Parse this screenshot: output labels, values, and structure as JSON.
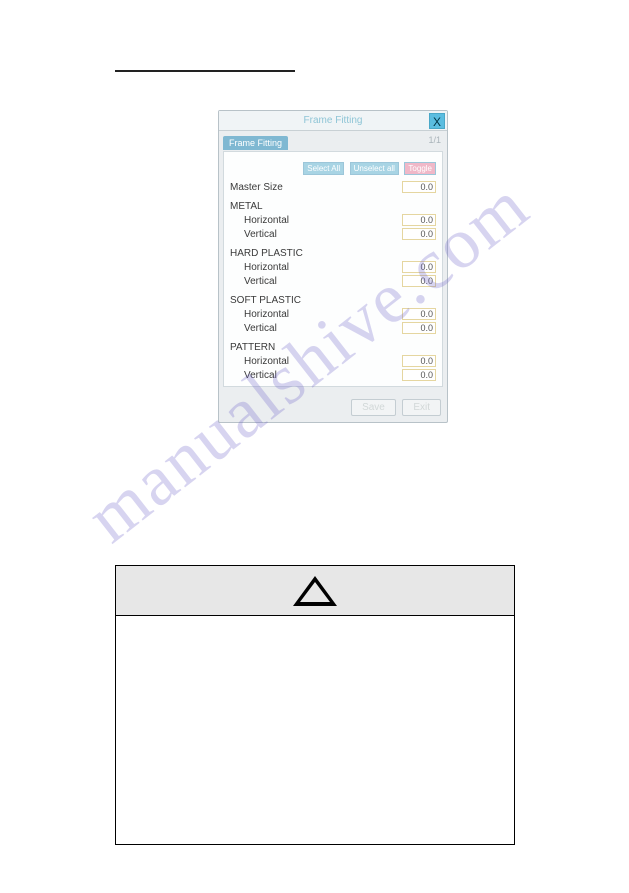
{
  "dialog": {
    "title": "Frame Fitting",
    "close": "X",
    "tab": "Frame Fitting",
    "pager": "1/1",
    "buttons": {
      "selectAll": "Select All",
      "unselectAll": "Unselect all",
      "toggle": "Toggle"
    },
    "master": {
      "label": "Master Size",
      "value": "0.0"
    },
    "groups": [
      {
        "name": "METAL",
        "rows": [
          {
            "label": "Horizontal",
            "value": "0.0"
          },
          {
            "label": "Vertical",
            "value": "0.0"
          }
        ]
      },
      {
        "name": "HARD PLASTIC",
        "rows": [
          {
            "label": "Horizontal",
            "value": "0.0"
          },
          {
            "label": "Vertical",
            "value": "0.0"
          }
        ]
      },
      {
        "name": "SOFT PLASTIC",
        "rows": [
          {
            "label": "Horizontal",
            "value": "0.0"
          },
          {
            "label": "Vertical",
            "value": "0.0"
          }
        ]
      },
      {
        "name": "PATTERN",
        "rows": [
          {
            "label": "Horizontal",
            "value": "0.0"
          },
          {
            "label": "Vertical",
            "value": "0.0"
          }
        ]
      }
    ],
    "footer": {
      "save": "Save",
      "exit": "Exit"
    }
  },
  "watermark": "manualshive.com"
}
